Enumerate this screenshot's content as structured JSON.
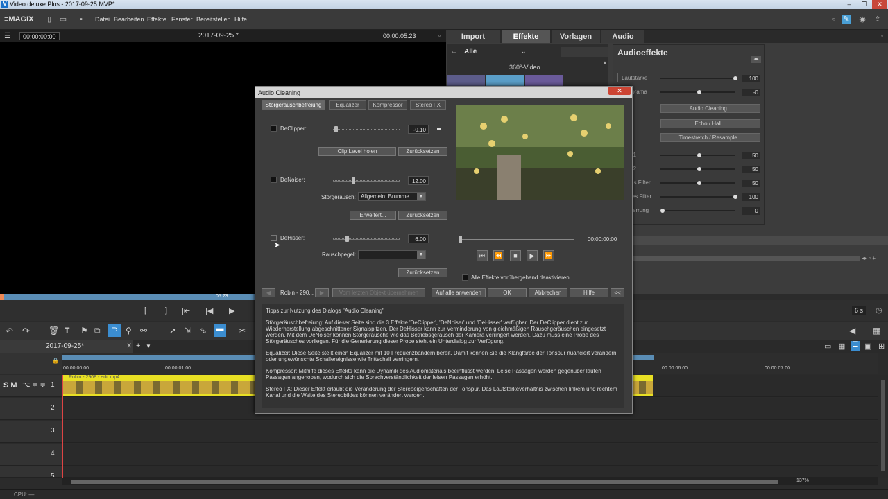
{
  "window": {
    "title": "Video deluxe Plus - 2017-09-25.MVP*",
    "min": "–",
    "max": "❐",
    "close": "✕"
  },
  "menubar": {
    "logo": "≡MAGIX",
    "items": [
      "Datei",
      "Bearbeiten",
      "Effekte",
      "Fenster",
      "Bereitstellen",
      "Hilfe"
    ]
  },
  "preview": {
    "timecode_start": "00:00:00:00",
    "project_title": "2017-09-25 *",
    "timecode_end": "00:00:05:23",
    "scrub_label": "05:23"
  },
  "right_tabs": [
    "Import",
    "Effekte",
    "Vorlagen",
    "Audio"
  ],
  "library": {
    "filter": "Alle",
    "category": "360°-Video"
  },
  "audio_effects": {
    "title": "Audioeffekte",
    "rows": [
      {
        "label": "Lautstärke",
        "value": "100",
        "level": 1.0
      },
      {
        "label": "Panorama",
        "value": "-0",
        "level": 0.5
      },
      {
        "label": "AUX1",
        "value": "50",
        "level": 0.5
      },
      {
        "label": "AUX2",
        "value": "50",
        "level": 0.5
      },
      {
        "label": "Tiefes Filter",
        "value": "50",
        "level": 0.5
      },
      {
        "label": "Hohes Filter",
        "value": "100",
        "level": 1.0
      },
      {
        "label": "Verzerrung",
        "value": "0",
        "level": 0.0
      }
    ],
    "buttons": [
      "Audio Cleaning...",
      "Echo / Hall...",
      "Timestretch / Resample..."
    ]
  },
  "timeline": {
    "tab_label": "2017-09-25*",
    "ruler": [
      "00:00:00:00",
      "00:00:01:00",
      "00:00:06:00",
      "00:00:07:00"
    ],
    "clip_name": "Robin - 2908 - edit.mp4",
    "tracks": [
      "1",
      "2",
      "3",
      "4",
      "5"
    ],
    "zoom_seconds": "6 s",
    "zoom_percent": "137%",
    "track_controls": "S M"
  },
  "status": {
    "cpu": "CPU: —"
  },
  "dialog": {
    "title": "Audio Cleaning",
    "tabs": [
      "Störgeräuschbefreiung",
      "Equalizer",
      "Kompressor",
      "Stereo FX"
    ],
    "declipper": {
      "label": "DeClipper:",
      "value": "-0.10",
      "level": 0.02
    },
    "clip_level_btn": "Clip Level holen",
    "reset": "Zurücksetzen",
    "denoiser": {
      "label": "DeNoiser:",
      "value": "12.00",
      "level": 0.3
    },
    "noise_label": "Störgeräusch:",
    "noise_value": "Allgemein: Brumme...",
    "advanced": "Erweitert...",
    "dehisser": {
      "label": "DeHisser:",
      "value": "6.00",
      "level": 0.2
    },
    "rausch_label": "Rauschpegel:",
    "rausch_value": "",
    "player_time": "00:00:00:00",
    "disable_all": "Alle Effekte vorübergehend deaktivieren",
    "nav_label": "Robin - 290...",
    "take_from_last": "Vom letzten Objekt übernehmen",
    "apply_all": "Auf alle anwenden",
    "ok": "OK",
    "cancel": "Abbrechen",
    "help": "Hilfe",
    "collapse": "<<",
    "tips": [
      "Tipps zur Nutzung des Dialogs \"Audio Cleaning\"",
      "Störgeräuschbefreiung: Auf dieser Seite sind die 3 Effekte 'DeClipper', 'DeNoiser' und 'DeHisser' verfügbar. Der DeClipper dient zur Wiederherstellung abgeschnittener Signalspitzen. Der DeHisser kann zur Verminderung von gleichmäßigen Rauschgeräuschen eingesetzt werden. Mit dem DeNoiser können Störgeräusche wie das Betriebsgeräusch der Kamera verringert werden. Dazu muss eine Probe des Störgeräusches vorliegen. Für die Generierung dieser Probe steht ein Unterdialog zur Verfügung.",
      "Equalizer: Diese Seite stellt einen Equalizer mit 10 Frequenzbändern bereit. Damit können Sie die Klangfarbe der Tonspur nuanciert verändern oder ungewünschte Schallereignisse wie Trittschall verringern.",
      "Kompressor: Mithilfe dieses Effekts kann die Dynamik des Audiomaterials beeinflusst werden. Leise Passagen werden gegenüber lauten Passagen angehoben, wodurch sich die Sprachverständlichkeit der leisen Passagen erhöht.",
      "Stereo FX: Dieser Effekt erlaubt die Veränderung der Stereoeigenschaften der Tonspur. Das Lautstärkeverhältnis zwischen linkem und rechtem Kanal und die Weite des Stereobildes können verändert werden."
    ]
  }
}
